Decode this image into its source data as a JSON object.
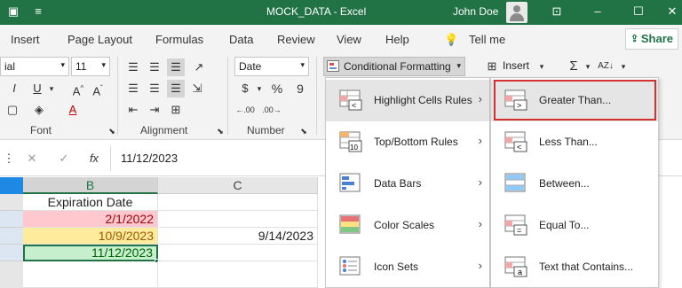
{
  "titlebar": {
    "title": "MOCK_DATA  -  Excel",
    "user": "John Doe"
  },
  "menu": {
    "tabs": [
      "Insert",
      "Page Layout",
      "Formulas",
      "Data",
      "Review",
      "View",
      "Help"
    ],
    "tell_me": "Tell me",
    "share": "Share"
  },
  "ribbon": {
    "font_name": "ial",
    "font_size": "11",
    "number_format": "Date",
    "conditional_formatting": "Conditional Formatting",
    "insert": "Insert",
    "groups": {
      "font": "Font",
      "alignment": "Alignment",
      "number": "Number"
    }
  },
  "formula_bar": {
    "value": "11/12/2023"
  },
  "sheet": {
    "col_b": "B",
    "col_c": "C",
    "header_b": "Expiration Date",
    "rows": [
      {
        "b": "2/1/2022",
        "c": ""
      },
      {
        "b": "10/9/2023",
        "c": "9/14/2023"
      },
      {
        "b": "11/12/2023",
        "c": ""
      }
    ],
    "colors": {
      "red_fill": "#ffc7ce",
      "red_text": "#9c0006",
      "yellow_fill": "#ffeb9c",
      "yellow_text": "#9c5700",
      "green_fill": "#c6efce",
      "green_text": "#006100"
    }
  },
  "cf_menu": {
    "items": [
      {
        "label": "Highlight Cells Rules",
        "icon": "highlight-cells-icon"
      },
      {
        "label": "Top/Bottom Rules",
        "icon": "top-bottom-icon"
      },
      {
        "label": "Data Bars",
        "icon": "data-bars-icon"
      },
      {
        "label": "Color Scales",
        "icon": "color-scales-icon"
      },
      {
        "label": "Icon Sets",
        "icon": "icon-sets-icon"
      }
    ]
  },
  "submenu": {
    "items": [
      {
        "label": "Greater Than...",
        "icon": "greater-than-icon"
      },
      {
        "label": "Less Than...",
        "icon": "less-than-icon"
      },
      {
        "label": "Between...",
        "icon": "between-icon"
      },
      {
        "label": "Equal To...",
        "icon": "equal-to-icon"
      },
      {
        "label": "Text that Contains...",
        "icon": "text-contains-icon"
      }
    ]
  },
  "accent": "#217346"
}
